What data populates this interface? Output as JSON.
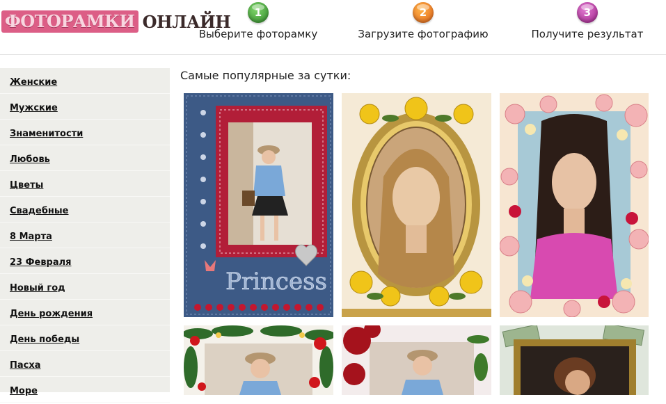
{
  "logo": {
    "part1": "ФОТОРАМКИ",
    "part2": "ОНЛАЙН"
  },
  "steps": [
    {
      "num": "1",
      "label": "Выберите фоторамку"
    },
    {
      "num": "2",
      "label": "Загрузите фотографию"
    },
    {
      "num": "3",
      "label": "Получите результат"
    }
  ],
  "sidebar": {
    "items": [
      "Женские",
      "Мужские",
      "Знаменитости",
      "Любовь",
      "Цветы",
      "Свадебные",
      "8 Марта",
      "23 Февраля",
      "Новый год",
      "День рождения",
      "День победы",
      "Пасха",
      "Море"
    ]
  },
  "main": {
    "heading": "Самые популярные за сутки:",
    "frame1_caption": "Princess"
  }
}
